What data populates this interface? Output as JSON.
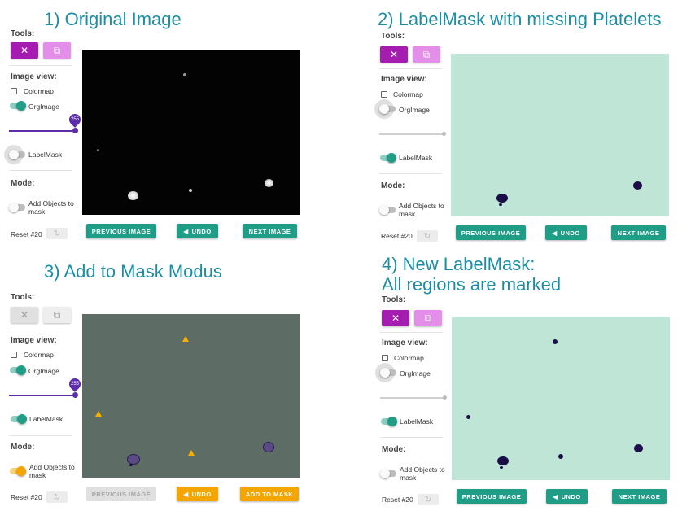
{
  "panels": {
    "p1": {
      "title": "1) Original Image",
      "tools_label": "Tools:",
      "image_view_label": "Image view:",
      "colormap_label": "Colormap",
      "orgimage_label": "OrgImage",
      "slider_value": "255",
      "labelmask_label": "LabelMask",
      "mode_label": "Mode:",
      "add_objects_label": "Add Objects to mask",
      "reset_label": "Reset #20",
      "btn_prev": "PREVIOUS IMAGE",
      "btn_undo": "UNDO",
      "btn_next": "NEXT IMAGE"
    },
    "p2": {
      "title": "2)  LabelMask with missing Platelets",
      "tools_label": "Tools:",
      "image_view_label": "Image view:",
      "colormap_label": "Colormap",
      "orgimage_label": "OrgImage",
      "labelmask_label": "LabelMask",
      "mode_label": "Mode:",
      "add_objects_label": "Add Objects to mask",
      "reset_label": "Reset #20",
      "btn_prev": "PREVIOUS IMAGE",
      "btn_undo": "UNDO",
      "btn_next": "NEXT IMAGE"
    },
    "p3": {
      "title": "3) Add to Mask Modus",
      "tools_label": "Tools:",
      "image_view_label": "Image view:",
      "colormap_label": "Colormap",
      "orgimage_label": "OrgImage",
      "slider_value": "255",
      "labelmask_label": "LabelMask",
      "mode_label": "Mode:",
      "add_objects_label": "Add Objects to mask",
      "reset_label": "Reset #20",
      "btn_prev": "PREVIOUS IMAGE",
      "btn_undo": "UNDO",
      "btn_add": "ADD TO MASK"
    },
    "p4": {
      "title_line1": "4) New LabelMask:",
      "title_line2": "All regions are marked",
      "tools_label": "Tools:",
      "image_view_label": "Image view:",
      "colormap_label": "Colormap",
      "orgimage_label": "OrgImage",
      "labelmask_label": "LabelMask",
      "mode_label": "Mode:",
      "add_objects_label": "Add Objects to mask",
      "reset_label": "Reset #20",
      "btn_prev": "PREVIOUS IMAGE",
      "btn_undo": "UNDO",
      "btn_next": "NEXT IMAGE"
    }
  },
  "icons": {
    "undo": "◀",
    "close": "✕",
    "copy": "⧉",
    "refresh": "↻"
  },
  "colors": {
    "title": "#1b8ea6",
    "teal": "#1f9d87",
    "orange": "#f5a500",
    "magenta": "#a51db0",
    "magenta_light": "#e38ee8",
    "slider_purple": "#5c2da8",
    "mask_bg": "#bfe5d6",
    "mask_blob": "#1b0d47"
  }
}
